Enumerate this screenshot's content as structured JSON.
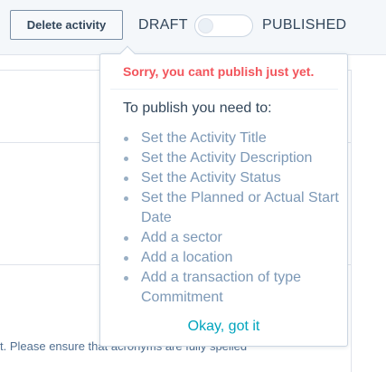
{
  "toolbar": {
    "delete_label": "Delete activity",
    "draft_label": "DRAFT",
    "published_label": "PUBLISHED",
    "publish_toggle_on": false
  },
  "background": {
    "partial_text": "t. Please ensure that acronyms are fully spelled"
  },
  "popover": {
    "title": "Sorry, you cant publish just yet.",
    "intro": "To publish you need to:",
    "requirements": [
      "Set the Activity Title",
      "Set the Activity Description",
      "Set the Activity Status",
      "Set the Planned or Actual Start Date",
      "Add a sector",
      "Add a location",
      "Add a transaction of type Commitment"
    ],
    "dismiss_label": "Okay, got it"
  },
  "colors": {
    "error": "#f2545b",
    "link": "#00a4bd",
    "text": "#33475b",
    "muted": "#7c98b6"
  }
}
